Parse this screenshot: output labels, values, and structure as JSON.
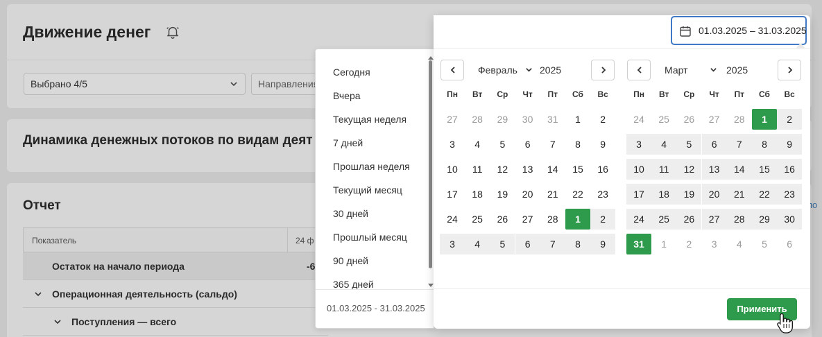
{
  "page": {
    "title": "Движение денег",
    "filter_selected": "Выбрано 4/5",
    "filter_direction_placeholder": "Направления",
    "section_title": "Динамика денежных потоков по видам деят",
    "report_title": "Отчет",
    "table_headers": [
      "Показатель",
      "24 ф"
    ],
    "rows": [
      {
        "label": "Остаток на начало периода",
        "value": "-6"
      },
      {
        "label": "Операционная деятельность (сальдо)",
        "value": ""
      },
      {
        "label": "Поступления — всего",
        "value": ""
      }
    ],
    "side_link": "по"
  },
  "presets": {
    "items": [
      "Сегодня",
      "Вчера",
      "Текущая неделя",
      "7 дней",
      "Прошлая неделя",
      "Текущий месяц",
      "30 дней",
      "Прошлый месяц",
      "90 дней",
      "365 дней"
    ],
    "footer_range": "01.03.2025 - 31.03.2025"
  },
  "picker": {
    "range_value": "01.03.2025 – 31.03.2025",
    "weekdays": [
      "Пн",
      "Вт",
      "Ср",
      "Чт",
      "Пт",
      "Сб",
      "Вс"
    ],
    "left": {
      "month": "Февраль",
      "year": "2025",
      "weeks": [
        [
          [
            "27",
            "o"
          ],
          [
            "28",
            "o"
          ],
          [
            "29",
            "o"
          ],
          [
            "30",
            "o"
          ],
          [
            "31",
            "o"
          ],
          [
            "1",
            ""
          ],
          [
            "2",
            ""
          ]
        ],
        [
          [
            "3",
            ""
          ],
          [
            "4",
            ""
          ],
          [
            "5",
            ""
          ],
          [
            "6",
            ""
          ],
          [
            "7",
            ""
          ],
          [
            "8",
            ""
          ],
          [
            "9",
            ""
          ]
        ],
        [
          [
            "10",
            ""
          ],
          [
            "11",
            ""
          ],
          [
            "12",
            ""
          ],
          [
            "13",
            ""
          ],
          [
            "14",
            ""
          ],
          [
            "15",
            ""
          ],
          [
            "16",
            ""
          ]
        ],
        [
          [
            "17",
            ""
          ],
          [
            "18",
            ""
          ],
          [
            "19",
            ""
          ],
          [
            "20",
            ""
          ],
          [
            "21",
            ""
          ],
          [
            "22",
            ""
          ],
          [
            "23",
            ""
          ]
        ],
        [
          [
            "24",
            ""
          ],
          [
            "25",
            ""
          ],
          [
            "26",
            ""
          ],
          [
            "27",
            ""
          ],
          [
            "28",
            ""
          ],
          [
            "1",
            "s"
          ],
          [
            "2",
            "r"
          ]
        ],
        [
          [
            "3",
            "r"
          ],
          [
            "4",
            "r"
          ],
          [
            "5",
            "r"
          ],
          [
            "6",
            "r"
          ],
          [
            "7",
            "r"
          ],
          [
            "8",
            "r"
          ],
          [
            "9",
            "r"
          ]
        ]
      ]
    },
    "right": {
      "month": "Март",
      "year": "2025",
      "weeks": [
        [
          [
            "24",
            "o"
          ],
          [
            "25",
            "o"
          ],
          [
            "26",
            "o"
          ],
          [
            "27",
            "o"
          ],
          [
            "28",
            "o"
          ],
          [
            "1",
            "s"
          ],
          [
            "2",
            "r"
          ]
        ],
        [
          [
            "3",
            "r"
          ],
          [
            "4",
            "r"
          ],
          [
            "5",
            "r"
          ],
          [
            "6",
            "r"
          ],
          [
            "7",
            "r"
          ],
          [
            "8",
            "r"
          ],
          [
            "9",
            "r"
          ]
        ],
        [
          [
            "10",
            "r"
          ],
          [
            "11",
            "r"
          ],
          [
            "12",
            "r"
          ],
          [
            "13",
            "r"
          ],
          [
            "14",
            "r"
          ],
          [
            "15",
            "r"
          ],
          [
            "16",
            "r"
          ]
        ],
        [
          [
            "17",
            "r"
          ],
          [
            "18",
            "r"
          ],
          [
            "19",
            "r"
          ],
          [
            "20",
            "r"
          ],
          [
            "21",
            "r"
          ],
          [
            "22",
            "r"
          ],
          [
            "23",
            "r"
          ]
        ],
        [
          [
            "24",
            "r"
          ],
          [
            "25",
            "r"
          ],
          [
            "26",
            "r"
          ],
          [
            "27",
            "r"
          ],
          [
            "28",
            "r"
          ],
          [
            "29",
            "r"
          ],
          [
            "30",
            "r"
          ]
        ],
        [
          [
            "31",
            "s"
          ],
          [
            "1",
            "o"
          ],
          [
            "2",
            "o"
          ],
          [
            "3",
            "o"
          ],
          [
            "4",
            "o"
          ],
          [
            "5",
            "o"
          ],
          [
            "6",
            "o"
          ]
        ]
      ]
    },
    "apply_label": "Применить"
  },
  "colors": {
    "accent_green": "#2e9a4b",
    "focus_blue": "#3f78c4"
  },
  "icons": {
    "bell": "bell-icon",
    "calendar": "calendar-icon",
    "prev": "chevron-left-icon",
    "next": "chevron-right-icon",
    "dropdown": "chevron-down-icon",
    "cursor": "hand-pointer-icon"
  }
}
